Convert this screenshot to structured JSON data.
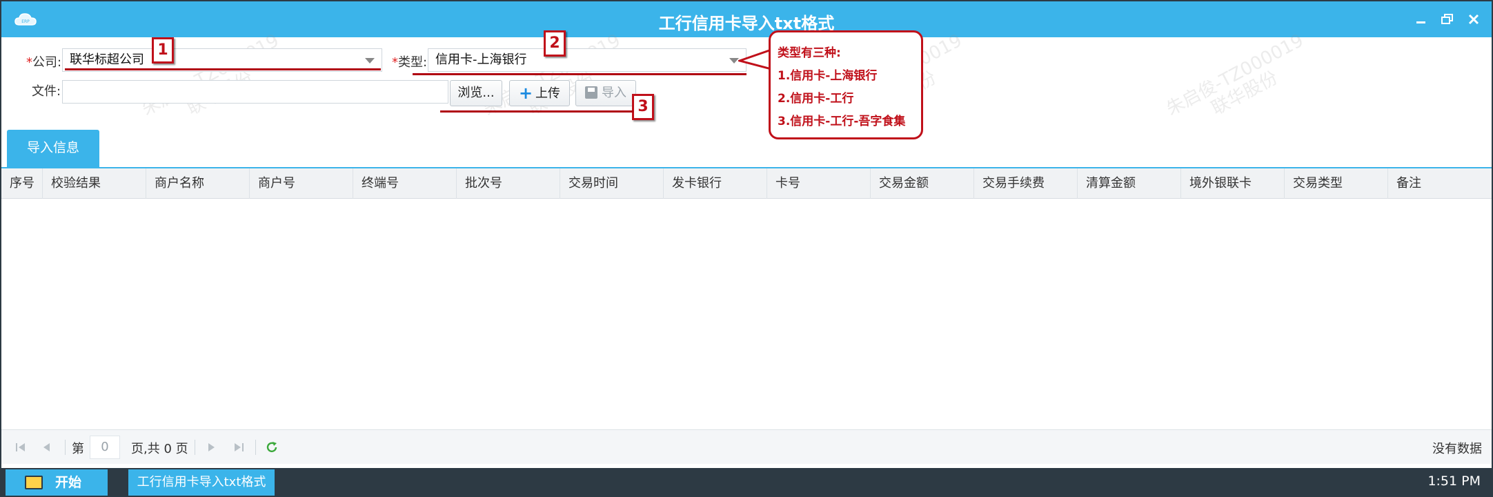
{
  "window": {
    "title": "工行信用卡导入txt格式"
  },
  "form": {
    "company_label": "公司:",
    "company_value": "联华标超公司",
    "type_label": "类型:",
    "type_value": "信用卡-上海银行",
    "file_label": "文件:",
    "file_value": "",
    "browse_label": "浏览...",
    "upload_label": "上传",
    "import_label": "导入"
  },
  "tabs": [
    {
      "label": "导入信息"
    }
  ],
  "grid": {
    "columns": [
      "序号",
      "校验结果",
      "商户名称",
      "商户号",
      "终端号",
      "批次号",
      "交易时间",
      "发卡银行",
      "卡号",
      "交易金额",
      "交易手续费",
      "清算金额",
      "境外银联卡",
      "交易类型",
      "备注"
    ]
  },
  "pager": {
    "page_prefix": "第",
    "page_value": "0",
    "page_suffix": "页,共 0 页",
    "empty_text": "没有数据"
  },
  "taskbar": {
    "start_label": "开始",
    "task_label": "工行信用卡导入txt格式",
    "clock": "1:51 PM"
  },
  "annotations": {
    "markers": [
      "1",
      "2",
      "3"
    ],
    "callout_lines": [
      "类型有三种:",
      "1.信用卡-上海银行",
      "2.信用卡-工行",
      "3.信用卡-工行-吾字食集"
    ]
  },
  "watermark": {
    "line1": "朱启俊-TZ000019",
    "line2": "联华股份"
  },
  "colors": {
    "accent": "#3bb4ea",
    "taskbar": "#2d3a44",
    "annotation_red": "#c0101a",
    "required_red": "#e02020"
  }
}
